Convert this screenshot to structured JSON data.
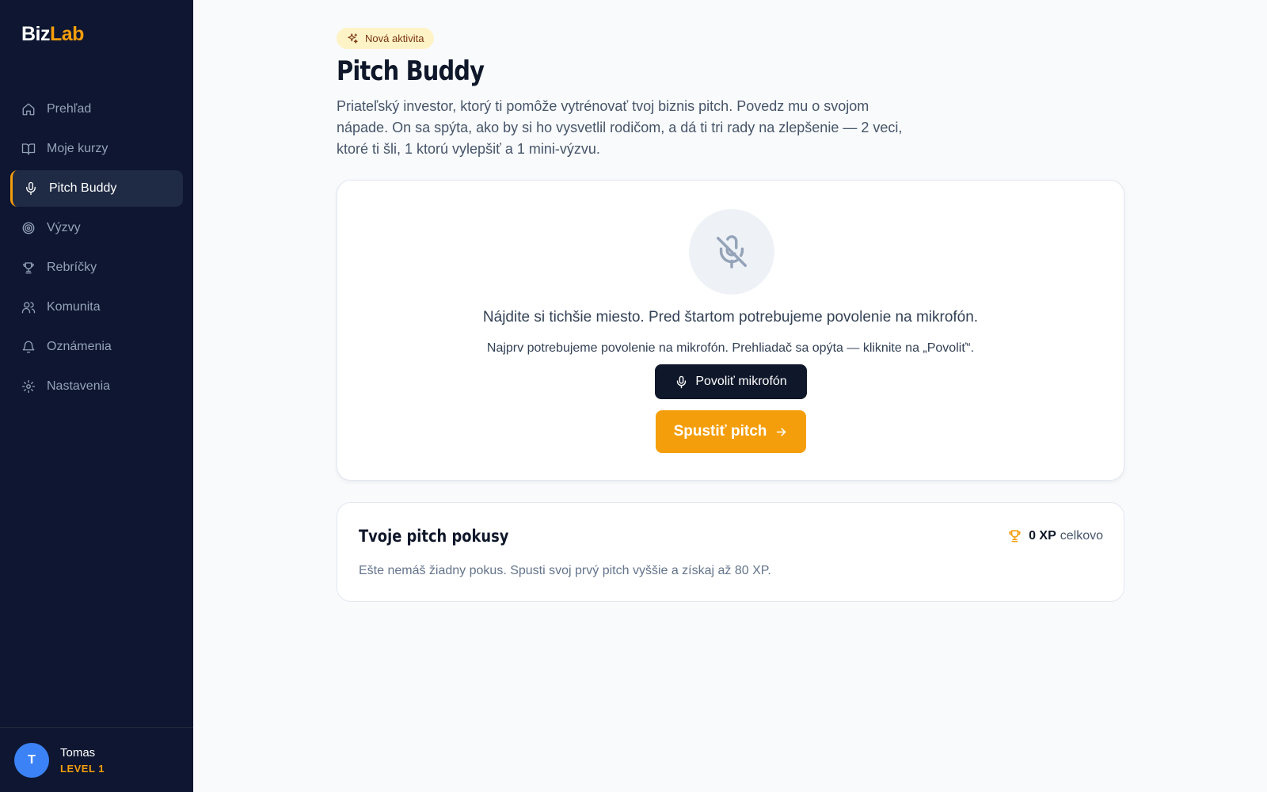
{
  "app": {
    "logo_part1": "Biz",
    "logo_part2": "Lab"
  },
  "sidebar": {
    "items": [
      {
        "label": "Prehľad",
        "icon": "home-icon"
      },
      {
        "label": "Moje kurzy",
        "icon": "book-icon"
      },
      {
        "label": "Pitch Buddy",
        "icon": "mic-icon",
        "active": true
      },
      {
        "label": "Výzvy",
        "icon": "target-icon"
      },
      {
        "label": "Rebríčky",
        "icon": "trophy-icon"
      },
      {
        "label": "Komunita",
        "icon": "users-icon"
      },
      {
        "label": "Oznámenia",
        "icon": "bell-icon"
      },
      {
        "label": "Nastavenia",
        "icon": "gear-icon"
      }
    ]
  },
  "user": {
    "initial": "T",
    "name": "Tomas",
    "level": "LEVEL 1"
  },
  "page": {
    "badge": "Nová aktivita",
    "title": "Pitch Buddy",
    "description": "Priateľský investor, ktorý ti pomôže vytrénovať tvoj biznis pitch. Povedz mu o svojom nápade. On sa spýta, ako by si ho vysvetlil rodičom, a dá ti tri rady na zlepšenie — 2 veci, ktoré ti šli, 1 ktorú vylepšiť a 1 mini-výzvu."
  },
  "mic_card": {
    "text1": "Nájdite si tichšie miesto. Pred štartom potrebujeme povolenie na mikrofón.",
    "text2": "Najprv potrebujeme povolenie na mikrofón. Prehliadač sa opýta — kliknite na „Povoliť“.",
    "allow_button": "Povoliť mikrofón",
    "start_button": "Spustiť pitch"
  },
  "attempts": {
    "title": "Tvoje pitch pokusy",
    "xp_value": "0 XP",
    "xp_suffix": "celkovo",
    "empty": "Ešte nemáš žiadny pokus. Spusti svoj prvý pitch vyššie a získaj až 80 XP."
  },
  "colors": {
    "sidebar_bg": "#0e1631",
    "accent": "#f59e0b",
    "avatar": "#3b82f6"
  }
}
